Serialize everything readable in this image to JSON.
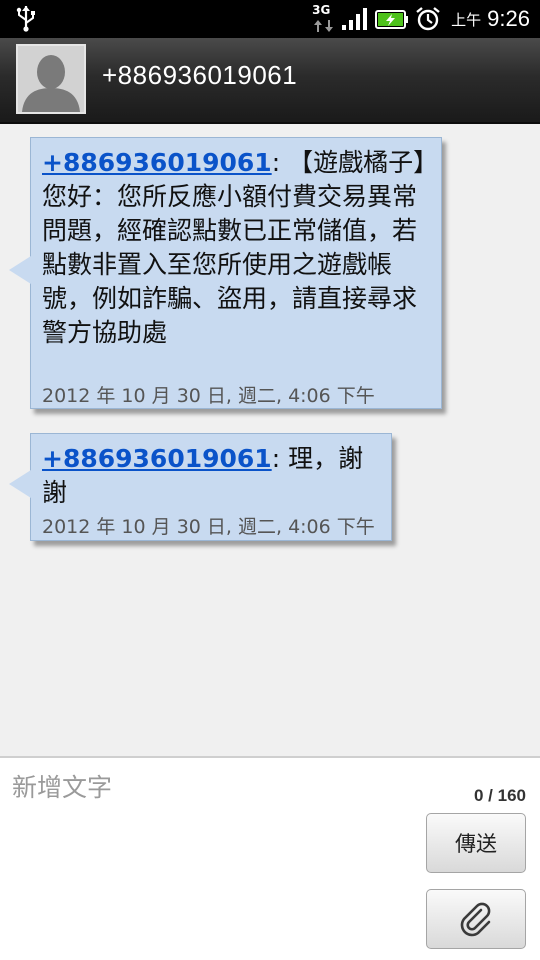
{
  "status_bar": {
    "network_type": "3G",
    "ampm": "上午",
    "time": "9:26",
    "icons": [
      "usb-icon",
      "3g-data-icon",
      "signal-icon",
      "battery-charging-icon",
      "alarm-icon"
    ],
    "battery_color": "#4ec21b"
  },
  "header": {
    "contact_number": "+886936019061",
    "avatar_icon": "default-contact-avatar-icon"
  },
  "messages": [
    {
      "sender": "+886936019061",
      "separator": ": ",
      "text": "【遊戲橘子】您好：您所反應小額付費交易異常問題，經確認點數已正常儲值，若點數非置入至您所使用之遊戲帳號，例如詐騙、盜用，請直接尋求警方協助處",
      "timestamp": "2012 年 10 月 30 日, 週二, 4:06 下午"
    },
    {
      "sender": "+886936019061",
      "separator": ": ",
      "text": "理，謝謝",
      "timestamp": "2012 年 10 月 30 日, 週二, 4:06 下午"
    }
  ],
  "compose": {
    "placeholder": "新增文字",
    "value": "",
    "char_count": "0 / 160",
    "send_label": "傳送",
    "attach_icon": "paperclip-icon"
  },
  "colors": {
    "bubble_bg": "#c8daf0",
    "link": "#0a53c9",
    "background": "#f0f0f0"
  }
}
